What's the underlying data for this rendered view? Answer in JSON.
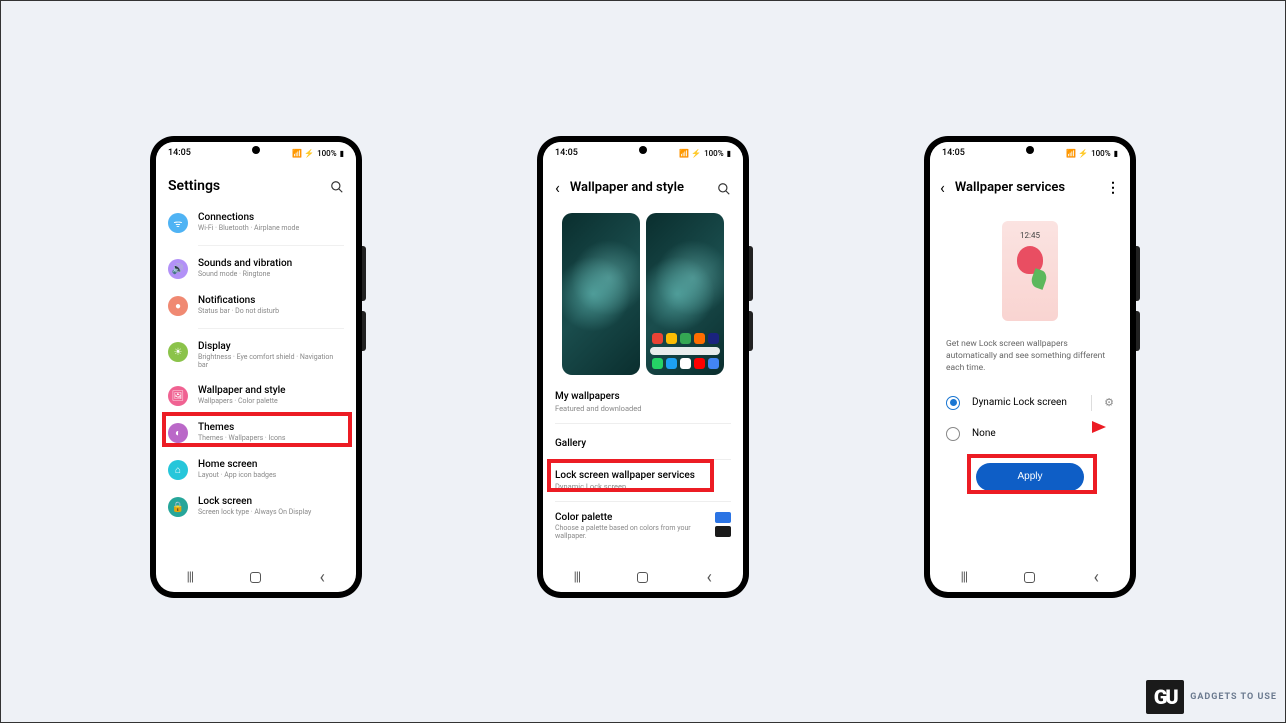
{
  "status": {
    "time": "14:05",
    "battery": "100%",
    "signal": "📶"
  },
  "screen1": {
    "title": "Settings",
    "items": [
      {
        "title": "Connections",
        "sub": "Wi-Fi  ·  Bluetooth  ·  Airplane mode"
      },
      {
        "title": "Sounds and vibration",
        "sub": "Sound mode  ·  Ringtone"
      },
      {
        "title": "Notifications",
        "sub": "Status bar  ·  Do not disturb"
      },
      {
        "title": "Display",
        "sub": "Brightness  ·  Eye comfort shield  ·  Navigation bar"
      },
      {
        "title": "Wallpaper and style",
        "sub": "Wallpapers  ·  Color palette"
      },
      {
        "title": "Themes",
        "sub": "Themes  ·  Wallpapers  ·  Icons"
      },
      {
        "title": "Home screen",
        "sub": "Layout  ·  App icon badges"
      },
      {
        "title": "Lock screen",
        "sub": "Screen lock type  ·  Always On Display"
      }
    ]
  },
  "screen2": {
    "title": "Wallpaper and style",
    "my_wallpapers": "My wallpapers",
    "my_wallpapers_sub": "Featured and downloaded",
    "gallery": "Gallery",
    "lock_services": "Lock screen wallpaper services",
    "lock_services_sub": "Dynamic Lock screen",
    "color_palette": "Color palette",
    "color_palette_sub": "Choose a palette based on colors from your wallpaper."
  },
  "screen3": {
    "title": "Wallpaper services",
    "preview_time": "12:45",
    "info": "Get new Lock screen wallpapers automatically and see something different each time.",
    "option1": "Dynamic Lock screen",
    "option2": "None",
    "apply": "Apply"
  },
  "watermark": {
    "logo": "GU",
    "text": "GADGETS TO USE"
  }
}
